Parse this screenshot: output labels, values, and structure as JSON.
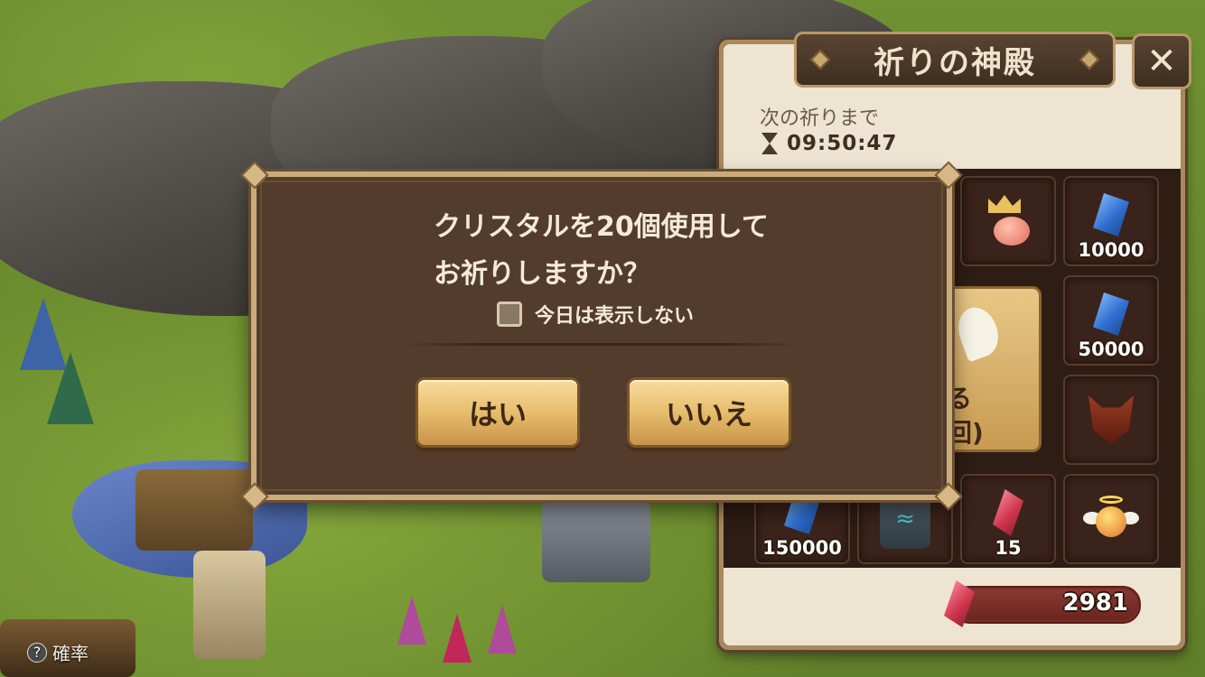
{
  "panel": {
    "title": "祈りの神殿",
    "close_glyph": "✕",
    "next_prayer_label": "次の祈りまで",
    "timer": "09:50:47",
    "pray_card": {
      "line1": "る",
      "line2": "回)"
    },
    "rewards": [
      {
        "icon": "royal-angel-icon",
        "count": ""
      },
      {
        "icon": "blue-crystal-icon",
        "count": "10000"
      },
      {
        "icon": "blue-crystal-icon",
        "count": "50000"
      },
      {
        "icon": "demon-icon",
        "count": ""
      },
      {
        "icon": "blue-crystal-icon",
        "count": "150000"
      },
      {
        "icon": "rune-icon",
        "count": ""
      },
      {
        "icon": "red-crystal-icon",
        "count": "15"
      },
      {
        "icon": "angel-icon",
        "count": ""
      }
    ],
    "crystal_balance": "2981"
  },
  "dialog": {
    "question_line1": "クリスタルを20個使用して",
    "question_line2": "お祈りしますか？",
    "checkbox_label": "今日は表示しない",
    "checkbox_checked": false,
    "yes_label": "はい",
    "no_label": "いいえ"
  },
  "footer": {
    "help_glyph": "?",
    "probability_label": "確率"
  },
  "colors": {
    "dialog_bg": "#533c2b",
    "dialog_border": "#c9ac7a",
    "button_gold": "#e6bd6c",
    "panel_header": "#eee4d2"
  }
}
